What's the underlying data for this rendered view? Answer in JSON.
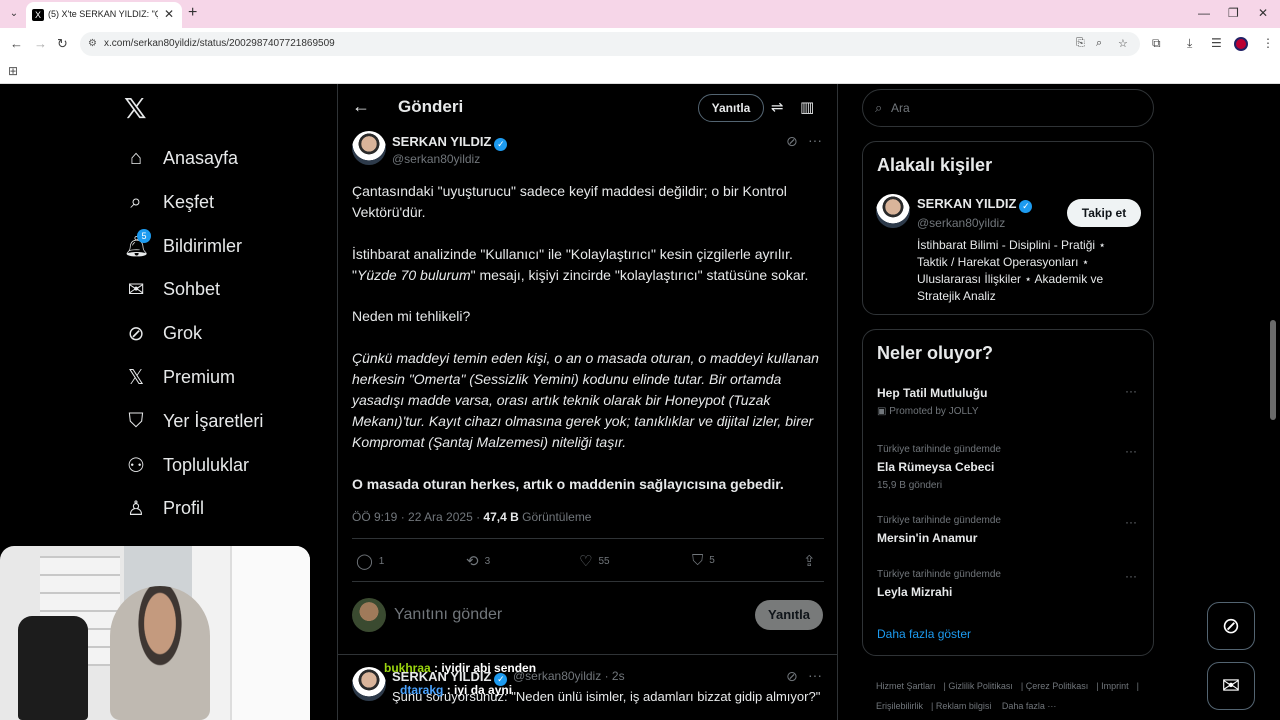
{
  "browser": {
    "tab_title": "(5) X'te SERKAN YILDIZ: \"Çanta…",
    "tab_favicon": "X",
    "url": "x.com/serkan80yildiz/status/2002987407721869509"
  },
  "sidebar": {
    "items": [
      {
        "label": "Anasayfa",
        "icon": "home-icon"
      },
      {
        "label": "Keşfet",
        "icon": "search-icon"
      },
      {
        "label": "Bildirimler",
        "icon": "bell-icon"
      },
      {
        "label": "Sohbet",
        "icon": "mail-icon"
      },
      {
        "label": "Grok",
        "icon": "grok-icon"
      },
      {
        "label": "Premium",
        "icon": "x-icon"
      },
      {
        "label": "Yer İşaretleri",
        "icon": "bookmark-icon"
      },
      {
        "label": "Topluluklar",
        "icon": "people-icon"
      },
      {
        "label": "Profil",
        "icon": "person-icon"
      }
    ],
    "notification_count": "5"
  },
  "header": {
    "title": "Gönderi",
    "reply_label": "Yanıtla"
  },
  "post": {
    "author": "SERKAN YILDIZ",
    "handle": "@serkan80yildiz",
    "p1": "Çantasındaki \"uyuşturucu\" sadece keyif maddesi değildir; o bir Kontrol Vektörü'dür.",
    "p2a": "İstihbarat analizinde \"Kullanıcı\" ile \"Kolaylaştırıcı\" kesin çizgilerle ayrılır. \"",
    "p2b": "Yüzde 70 bulurum",
    "p2c": "\" mesajı, kişiyi zincirde \"kolaylaştırıcı\" statüsüne sokar.",
    "p3": "Neden mi tehlikeli?",
    "p4": "Çünkü maddeyi temin eden kişi, o an o masada oturan, o maddeyi kullanan herkesin \"Omerta\" (Sessizlik Yemini) kodunu elinde tutar. Bir ortamda yasadışı madde varsa, orası artık teknik olarak bir Honeypot (Tuzak Mekanı)'tur. Kayıt cihazı olmasına gerek yok; tanıklıklar ve dijital izler, birer Kompromat (Şantaj Malzemesi) niteliği taşır.",
    "p5": "O masada oturan herkes, artık o maddenin sağlayıcısına gebedir.",
    "time": "ÖÖ 9:19 · 22 Ara 2025 · ",
    "views": "47,4 B",
    "views_label": " Görüntüleme",
    "replies": "1",
    "reposts": "3",
    "likes": "55",
    "bookmarks": "5"
  },
  "reply_box": {
    "placeholder": "Yanıtını gönder",
    "button": "Yanıtla"
  },
  "next_post": {
    "author": "SERKAN YILDIZ",
    "handle": "@serkan80yildiz",
    "age": "· 2s",
    "text": "Şunu soruyorsunuz: \"Neden ünlü isimler, iş adamları bizzat gidip almıyor?\""
  },
  "search": {
    "placeholder": "Ara"
  },
  "related": {
    "title": "Alakalı kişiler",
    "name": "SERKAN YILDIZ",
    "handle": "@serkan80yildiz",
    "follow": "Takip et",
    "bio": "İstihbarat Bilimi - Disiplini - Pratiği ⋆ Taktik / Harekat Operasyonları ⋆ Uluslararası İlişkiler ⋆ Akademik ve Stratejik Analiz"
  },
  "trends": {
    "title": "Neler oluyor?",
    "items": [
      {
        "context": "",
        "name": "Hep Tatil Mutluluğu",
        "sub": "Promoted by JOLLY"
      },
      {
        "context": "Türkiye tarihinde gündemde",
        "name": "Ela Rümeysa Cebeci",
        "sub": "15,9 B gönderi"
      },
      {
        "context": "Türkiye tarihinde gündemde",
        "name": "Mersin'in Anamur",
        "sub": ""
      },
      {
        "context": "Türkiye tarihinde gündemde",
        "name": "Leyla Mizrahi",
        "sub": ""
      }
    ],
    "show_more": "Daha fazla göster"
  },
  "footer": {
    "links": [
      "Hizmet Şartları",
      "Gizlilik Politikası",
      "Çerez Politikası",
      "Imprint",
      "Erişilebilirlik",
      "Reklam bilgisi",
      "Daha fazla ···"
    ]
  },
  "chat": [
    {
      "user": "bukhraa",
      "msg": " : iyidir abi senden"
    },
    {
      "user": "dtarakg",
      "msg": " : iyi da ayni"
    }
  ]
}
